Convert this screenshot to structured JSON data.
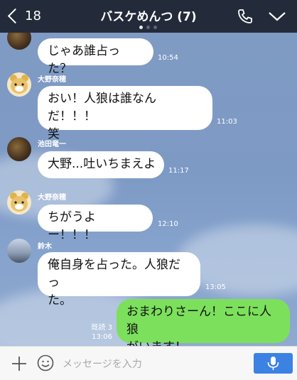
{
  "header": {
    "back_count": "18",
    "title": "バスケめんつ (7)"
  },
  "messages": [
    {
      "sender": "",
      "text": "じゃあ誰占った？",
      "time": "10:54"
    },
    {
      "sender": "大野奈穂",
      "text": "おい！人狼は誰なんだ！！！笑",
      "line1": "おい！人狼は誰なんだ！！！",
      "line2": "笑",
      "time": "11:03"
    },
    {
      "sender": "池田竜一",
      "text": "大野...吐いちまえよ",
      "time": "11:17"
    },
    {
      "sender": "大野奈穂",
      "text": "ちがうよー！！！",
      "time": "12:10"
    },
    {
      "sender": "鈴木",
      "text": "俺自身を占った。人狼だった。",
      "line1": "俺自身を占った。人狼だっ",
      "line2": "た。",
      "time": "13:05"
    },
    {
      "sender": "me",
      "text": "おまわりさーん！ここに人狼がいます！",
      "line1": "おまわりさーん！ここに人狼",
      "line2": "がいます！",
      "read": "既読 3",
      "time": "13:06"
    }
  ],
  "footer": {
    "placeholder": "メッセージを入力"
  },
  "icons": [
    "back-chevron-icon",
    "phone-icon",
    "dropdown-chevron-icon",
    "plus-icon",
    "emoji-icon",
    "mic-icon"
  ],
  "colors": {
    "header_bg": "#232b3a",
    "chat_bg": "#7f9bc4",
    "bubble_in": "#ffffff",
    "bubble_out": "#7ce05c",
    "send_button": "#3b82e3"
  }
}
